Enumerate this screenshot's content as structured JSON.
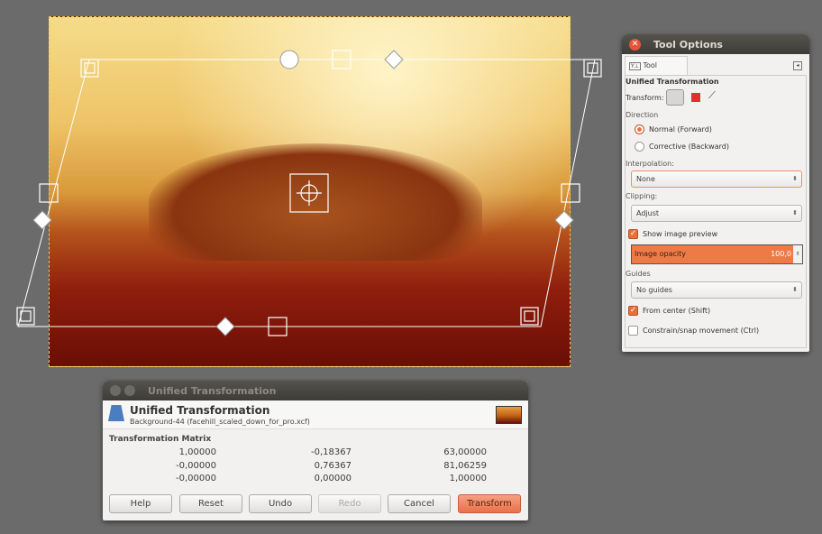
{
  "tool_options": {
    "title": "Tool Options",
    "tab": "Tool Options",
    "section": "Unified Transformation",
    "transform_label": "Transform:",
    "direction_label": "Direction",
    "direction_options": [
      "Normal (Forward)",
      "Corrective (Backward)"
    ],
    "direction_selected": 0,
    "interpolation_label": "Interpolation:",
    "interpolation": "None",
    "clipping_label": "Clipping:",
    "clipping": "Adjust",
    "show_preview": "Show image preview",
    "show_preview_checked": true,
    "opacity_label": "Image opacity",
    "opacity_value": "100,0",
    "guides_label": "Guides",
    "guides": "No guides",
    "from_center": "From center  (Shift)",
    "from_center_checked": true,
    "constrain": "Constrain/snap movement  (Ctrl)",
    "constrain_checked": false,
    "accent": "#e8703a"
  },
  "dialog": {
    "title": "Unified Transformation",
    "heading": "Unified Transformation",
    "subtitle": "Background-44 (facehill_scaled_down_for_pro.xcf)",
    "matrix_label": "Transformation Matrix",
    "matrix": [
      [
        "1,00000",
        "-0,18367",
        "63,00000"
      ],
      [
        "-0,00000",
        "0,76367",
        "81,06259"
      ],
      [
        "-0,00000",
        "0,00000",
        "1,00000"
      ]
    ],
    "buttons": {
      "help": "Help",
      "reset": "Reset",
      "undo": "Undo",
      "redo": "Redo",
      "cancel": "Cancel",
      "transform": "Transform"
    }
  }
}
